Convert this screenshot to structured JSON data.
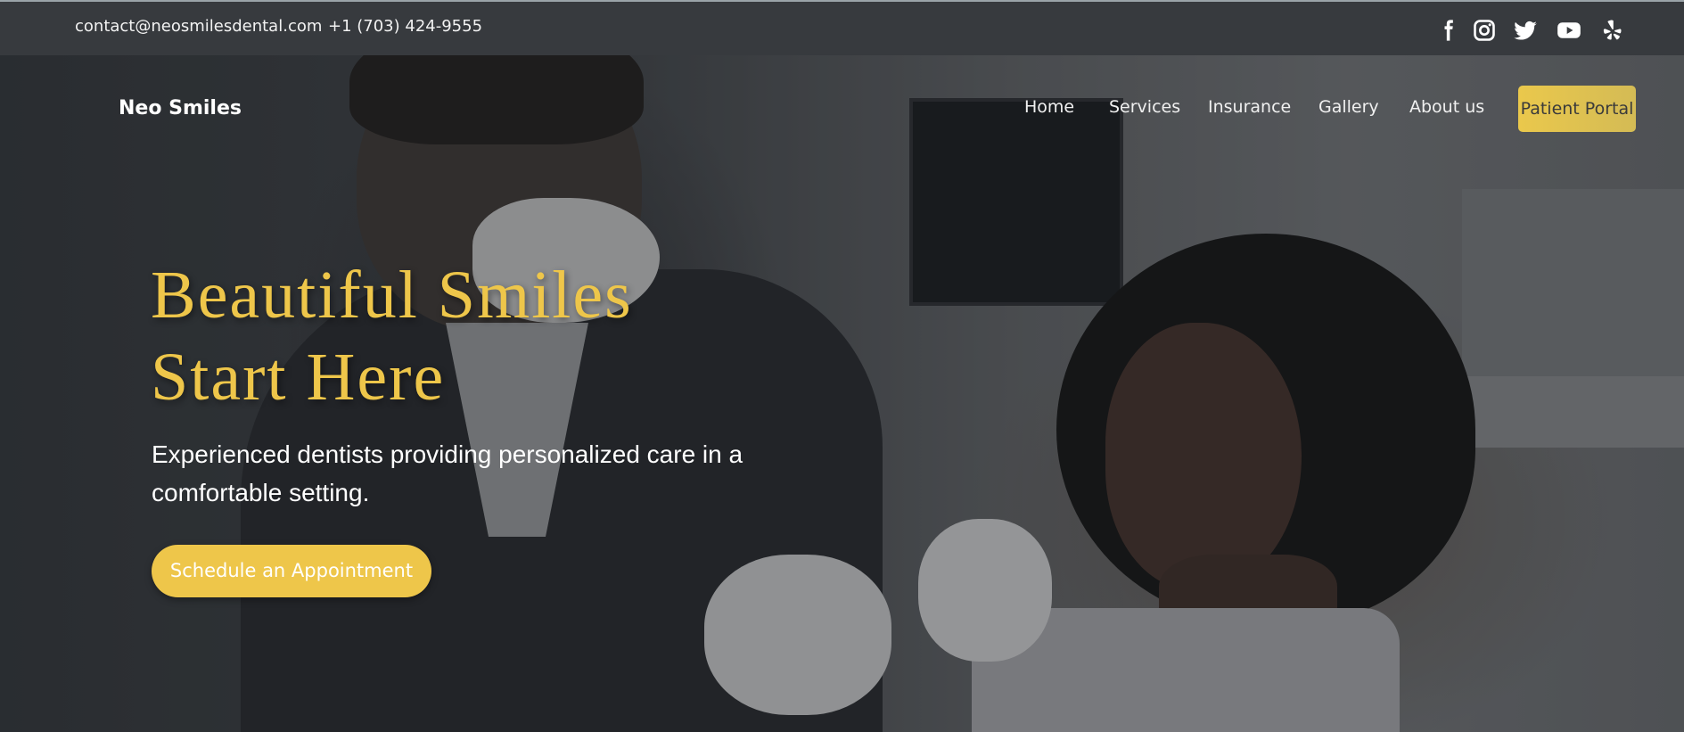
{
  "topbar": {
    "email": "contact@neosmilesdental.com",
    "phone": "+1 (703) 424-9555",
    "social_icons": [
      "facebook-icon",
      "instagram-icon",
      "twitter-icon",
      "youtube-icon",
      "yelp-icon"
    ]
  },
  "nav": {
    "brand": "Neo Smiles",
    "links": [
      "Home",
      "Services",
      "Insurance",
      "Gallery",
      "About us"
    ],
    "portal_button": "Patient Portal"
  },
  "hero": {
    "headline_line1": "Beautiful Smiles",
    "headline_line2": "Start Here",
    "subtext": "Experienced dentists providing personalized care in a comfortable setting.",
    "cta": "Schedule an Appointment"
  },
  "colors": {
    "accent": "#eec64a",
    "topbar": "#373a3e",
    "text_light": "#ffffff"
  }
}
